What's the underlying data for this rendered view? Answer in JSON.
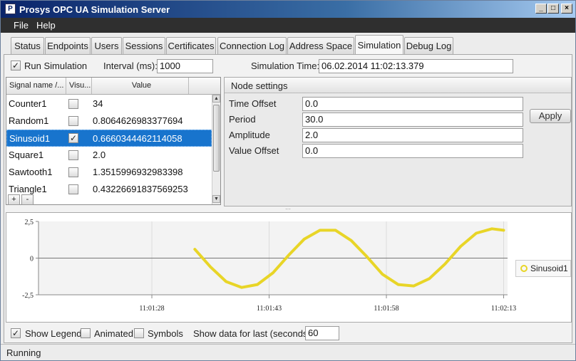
{
  "window": {
    "title": "Prosys OPC UA Simulation Server"
  },
  "menu": [
    "File",
    "Help"
  ],
  "tabs": [
    "Status",
    "Endpoints",
    "Users",
    "Sessions",
    "Certificates",
    "Connection Log",
    "Address Space",
    "Simulation",
    "Debug Log"
  ],
  "active_tab": "Simulation",
  "toolbar": {
    "run_simulation_label": "Run Simulation",
    "run_simulation_checked": true,
    "interval_label": "Interval (ms):",
    "interval_value": "1000",
    "sim_time_label": "Simulation Time:",
    "sim_time_value": "06.02.2014 11:02:13.379"
  },
  "signal_table": {
    "headers": [
      "Signal name /...",
      "Visu...",
      "Value"
    ],
    "rows": [
      {
        "name": "Counter1",
        "visible": false,
        "value": "34"
      },
      {
        "name": "Random1",
        "visible": false,
        "value": "0.8064626983377694"
      },
      {
        "name": "Sinusoid1",
        "visible": true,
        "value": "0.6660344462114058",
        "selected": true
      },
      {
        "name": "Square1",
        "visible": false,
        "value": "2.0"
      },
      {
        "name": "Sawtooth1",
        "visible": false,
        "value": "1.3515996932983398"
      },
      {
        "name": "Triangle1",
        "visible": false,
        "value": "0.43226691837569253"
      }
    ],
    "add_label": "+",
    "remove_label": "-"
  },
  "node_settings": {
    "title": "Node settings",
    "fields": [
      {
        "label": "Time Offset",
        "value": "0.0"
      },
      {
        "label": "Period",
        "value": "30.0"
      },
      {
        "label": "Amplitude",
        "value": "2.0"
      },
      {
        "label": "Value Offset",
        "value": "0.0"
      }
    ],
    "apply_label": "Apply"
  },
  "chart_data": {
    "type": "line",
    "series": [
      {
        "name": "Sinusoid1",
        "color": "#e8d527",
        "x": [
          -39.5,
          -37.5,
          -35.5,
          -33.5,
          -31.5,
          -29.5,
          -27.5,
          -25.5,
          -23.5,
          -21.5,
          -19.5,
          -17.5,
          -15.5,
          -13.5,
          -11.5,
          -9.5,
          -7.5,
          -5.5,
          -3.5,
          -1.5,
          0.0
        ],
        "values": [
          0.6,
          -0.6,
          -1.6,
          -2.0,
          -1.8,
          -1.0,
          0.2,
          1.3,
          1.9,
          1.9,
          1.2,
          0.1,
          -1.1,
          -1.8,
          -1.9,
          -1.4,
          -0.4,
          0.8,
          1.7,
          2.0,
          1.9
        ]
      }
    ],
    "xlabel": "",
    "ylabel": "",
    "y_ticks": [
      "2,5",
      "0",
      "-2,5"
    ],
    "ylim": [
      -2.5,
      2.5
    ],
    "x_tick_labels": [
      "11:01:28",
      "11:01:43",
      "11:01:58",
      "11:02:13"
    ],
    "x_ticks_seconds_before_end": [
      -45,
      -30,
      -15,
      0
    ],
    "xlim_seconds_before_end": [
      -59.5,
      0.5
    ],
    "legend": "right",
    "grid": true
  },
  "bottom_toolbar": {
    "show_legend_label": "Show Legend",
    "show_legend_checked": true,
    "animated_label": "Animated",
    "animated_checked": false,
    "symbols_label": "Symbols",
    "symbols_checked": false,
    "show_data_label": "Show data for last (seconds)",
    "show_data_value": "60"
  },
  "status": "Running"
}
